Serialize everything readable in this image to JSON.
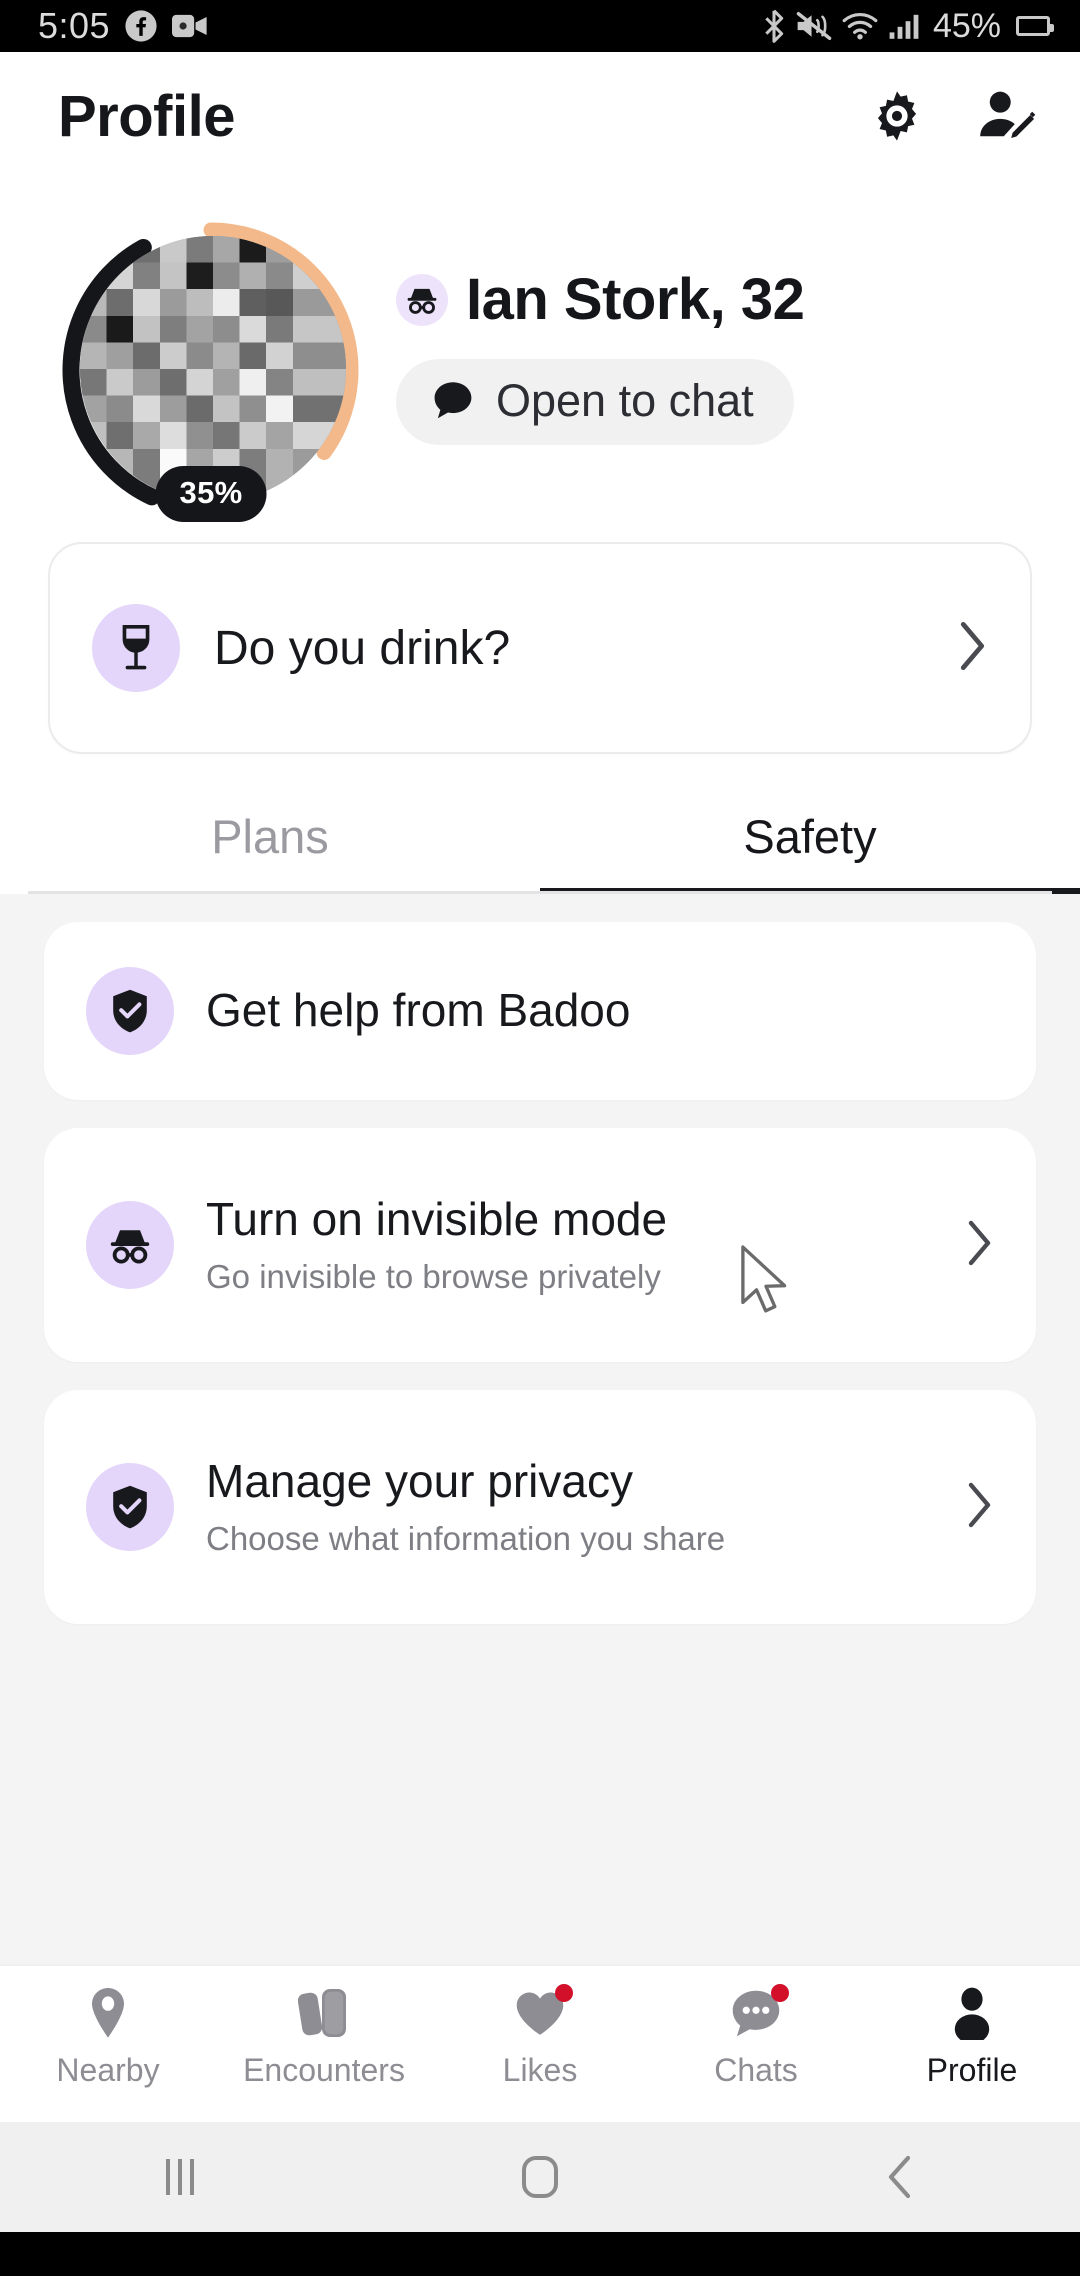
{
  "status_bar": {
    "time": "5:05",
    "left_icons": [
      "facebook-icon",
      "video-camera-icon"
    ],
    "right_icons": [
      "bluetooth-icon",
      "volume-mute-icon",
      "wifi-icon",
      "cellular-signal-icon"
    ],
    "battery_percent": "45%"
  },
  "header": {
    "title": "Profile",
    "actions": [
      {
        "name": "settings-gear",
        "icon": "gear-icon"
      },
      {
        "name": "edit-profile",
        "icon": "person-edit-icon"
      }
    ]
  },
  "profile": {
    "name_age": "Ian Stork, 32",
    "incognito_badge_icon": "incognito-icon",
    "completion_percent": "35%",
    "completion_value": 35,
    "status_chip": {
      "label": "Open to chat",
      "icon": "chat-bubble-icon"
    },
    "avatar": {
      "name": "profile-photo",
      "censored": true
    }
  },
  "prompt_card": {
    "title": "Do you drink?",
    "icon": "wine-glass-icon",
    "chevron": "chevron-right-icon"
  },
  "tabs": [
    {
      "label": "Plans",
      "active": false
    },
    {
      "label": "Safety",
      "active": true
    }
  ],
  "safety_items": [
    {
      "title": "Get help from Badoo",
      "subtitle": "",
      "icon": "shield-check-icon",
      "has_chevron": false
    },
    {
      "title": "Turn on invisible mode",
      "subtitle": "Go invisible to browse privately",
      "icon": "incognito-icon",
      "has_chevron": true
    },
    {
      "title": "Manage your privacy",
      "subtitle": "Choose what information you share",
      "icon": "shield-check-icon",
      "has_chevron": true
    }
  ],
  "bottom_nav": [
    {
      "label": "Nearby",
      "icon": "location-pin-icon",
      "active": false,
      "badge": false
    },
    {
      "label": "Encounters",
      "icon": "cards-stack-icon",
      "active": false,
      "badge": false
    },
    {
      "label": "Likes",
      "icon": "heart-icon",
      "active": false,
      "badge": true
    },
    {
      "label": "Chats",
      "icon": "chat-dots-icon",
      "active": false,
      "badge": true
    },
    {
      "label": "Profile",
      "icon": "person-icon",
      "active": true,
      "badge": false
    }
  ],
  "android_nav": [
    {
      "name": "recents-button",
      "icon": "recents-icon"
    },
    {
      "name": "home-button",
      "icon": "home-icon"
    },
    {
      "name": "back-button",
      "icon": "back-icon"
    }
  ],
  "colors": {
    "accent_lavender": "#e4d6fa",
    "badge_lavender": "#ede3fb",
    "text_primary": "#18191d",
    "text_secondary": "#7e7f85",
    "notification_red": "#d2102a",
    "list_background": "#f4f4f4",
    "progress_ring": "#15161a",
    "progress_track": "#f3b98a"
  }
}
